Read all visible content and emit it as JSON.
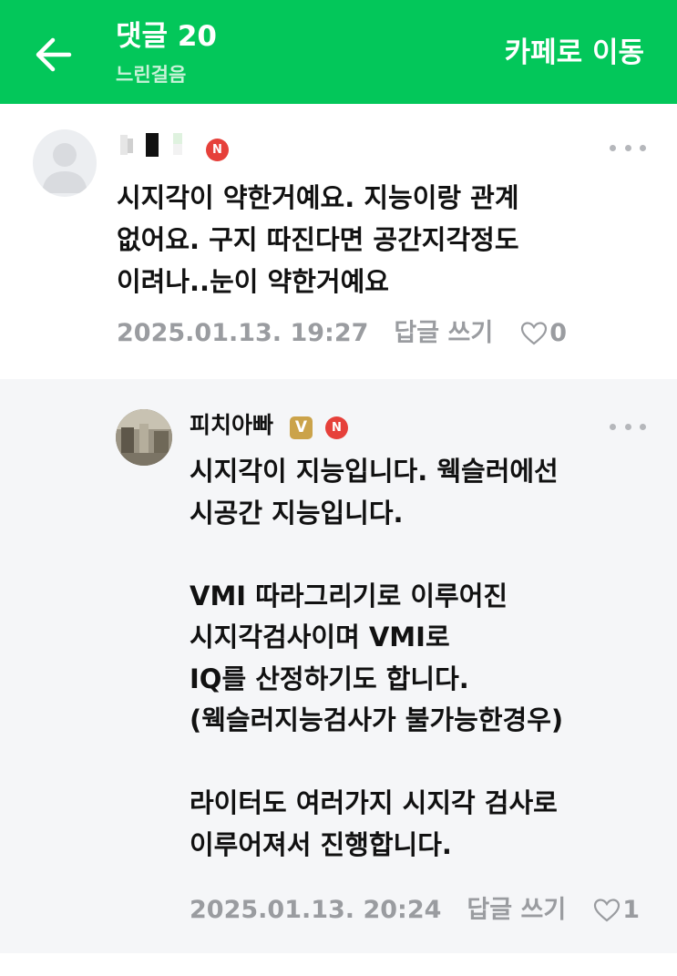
{
  "header": {
    "title": "댓글 20",
    "subtitle": "느린걸음",
    "cafe_link": "카페로 이동",
    "background": "#03c75a"
  },
  "comments": [
    {
      "author": "",
      "body": "시지각이 약한거예요. 지능이랑 관계\n없어요. 구지 따진다면 공간지각정도\n이려나..눈이 약한거예요",
      "date": "2025.01.13. 19:27",
      "reply_label": "답글 쓰기",
      "likes": "0",
      "badge": "N"
    },
    {
      "author": "피치아빠",
      "level_badge": "V",
      "badge": "N",
      "body": "시지각이 지능입니다. 웩슬러에선\n시공간 지능입니다.\n\nVMI 따라그리기로 이루어진\n시지각검사이며 VMI로\nIQ를 산정하기도 합니다.\n(웩슬러지능검사가 불가능한경우)\n\n라이터도 여러가지 시지각 검사로\n이루어져서 진행합니다.",
      "date": "2025.01.13. 20:24",
      "reply_label": "답글 쓰기",
      "likes": "1"
    }
  ]
}
